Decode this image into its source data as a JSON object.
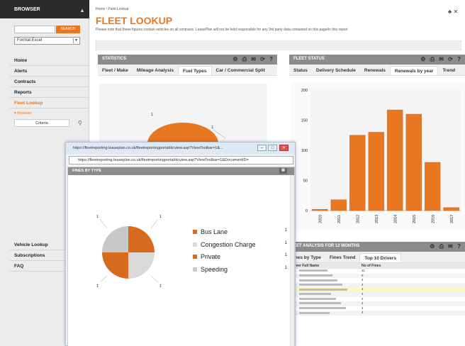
{
  "sidebar": {
    "title": "BROWSER",
    "search_button": "SEARCH",
    "format_select": "Format Excel",
    "nav": [
      "Home",
      "Alerts",
      "Contracts",
      "Reports",
      "Fleet Lookup"
    ],
    "browser_label": "Browser",
    "criteria_label": "Criteria",
    "bottom_nav": [
      "Vehicle Lookup",
      "Subscriptions",
      "FAQ"
    ]
  },
  "header": {
    "breadcrumb": "Home / Fleet Lookup",
    "title": "FLEET LOOKUP",
    "note": "Please note that these figures contain vehicles on all contracts. LeasePlan will not be held responsible for any 3rd party data contained on this page/in this report"
  },
  "statistics": {
    "title": "STATISTICS",
    "tabs": [
      "Fleet / Make",
      "Mileage Analysis",
      "Fuel Types",
      "Car / Commercial Split"
    ],
    "active_tab": "Fuel Types",
    "label": "1"
  },
  "fleet_status": {
    "title": "FLEET STATUS",
    "tabs": [
      "Status",
      "Delivery Schedule",
      "Renewals",
      "Renewals by year",
      "Trend"
    ],
    "active_tab": "Renewals by year"
  },
  "fines": {
    "title": "FINES ANALYSIS FOR 12 MONTHS",
    "title_visible": "EET ANALYSIS FOR 12 MONTHS",
    "tabs": [
      "ines by Type",
      "Fines Trend",
      "Top 10 Drivers"
    ],
    "active_tab": "Top 10 Drivers",
    "columns": [
      "river Full Name",
      "No of Fines"
    ],
    "values": [
      "11",
      "5",
      "4",
      "4",
      "4",
      "4",
      "4",
      "4",
      "4",
      "4"
    ]
  },
  "popup": {
    "title": "https://fleetreporting.leaseplan.co.uk/fleetreportingportal/dcview.asp?ViewToolbar=1&...",
    "address": "https://fleetreporting.leaseplan.co.uk/fleetreportingportal/dcview.asp?ViewToolbar=1&DocumentID=",
    "panel_title": "FINES BY TYPE",
    "legend": [
      {
        "label": "Bus Lane",
        "value": "1",
        "color": "#d86a1e"
      },
      {
        "label": "Congestion Charge",
        "value": "1",
        "color": "#d9d9d9"
      },
      {
        "label": "Private",
        "value": "1",
        "color": "#d86a1e"
      },
      {
        "label": "Speeding",
        "value": "1",
        "color": "#c8c8c8"
      }
    ],
    "slice_label": "1"
  },
  "colors": {
    "accent": "#e87722",
    "panel_header": "#8c8c8c",
    "popup_chrome": "#dfe8f5"
  },
  "chart_data": [
    {
      "type": "bar",
      "categories": [
        "2010",
        "2011",
        "2012",
        "2013",
        "2014",
        "2015",
        "2016",
        "2017"
      ],
      "values": [
        2,
        18,
        125,
        130,
        167,
        160,
        80,
        5
      ],
      "ylim": [
        0,
        200
      ],
      "yticks": [
        "200",
        "150",
        "100",
        "50",
        "0"
      ],
      "xlabel": "",
      "ylabel": "",
      "grid": false
    },
    {
      "type": "pie",
      "categories": [
        "Bus Lane",
        "Congestion Charge",
        "Private",
        "Speeding"
      ],
      "values": [
        1,
        1,
        1,
        1
      ]
    }
  ]
}
